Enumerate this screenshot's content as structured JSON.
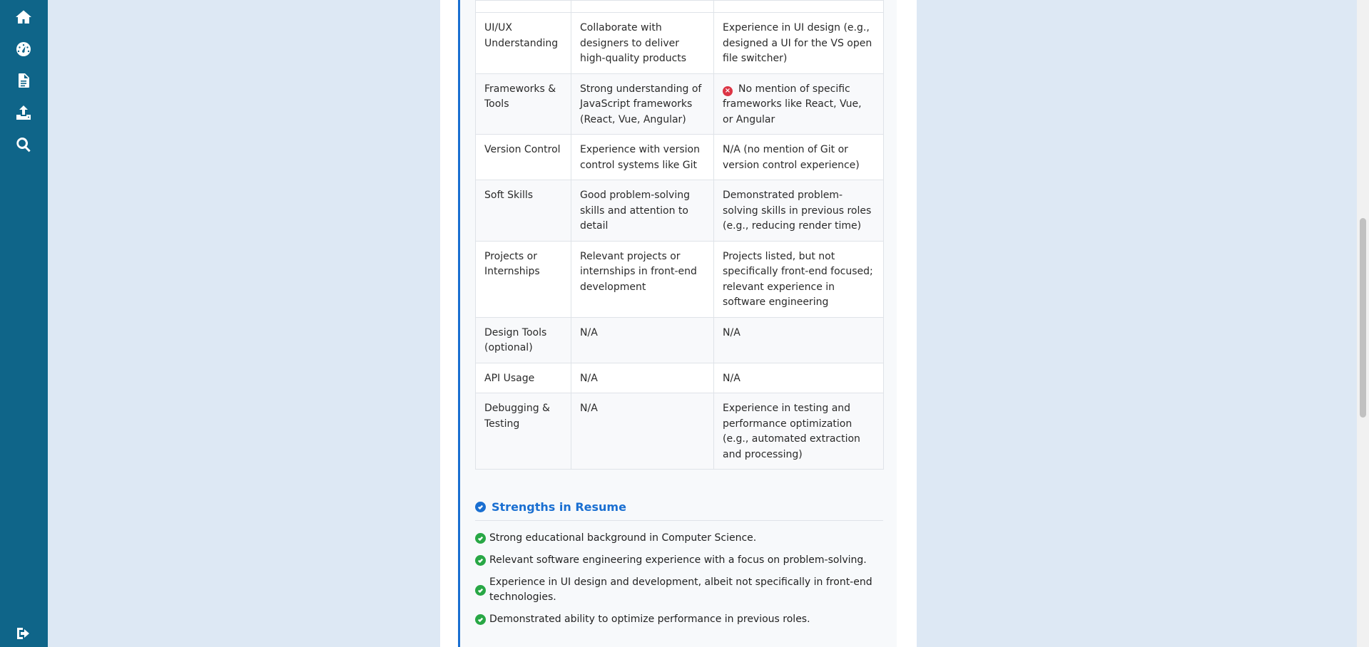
{
  "sidebar": {
    "icons": [
      "home-icon",
      "dashboard-icon",
      "document-icon",
      "upload-icon",
      "search-icon",
      "logout-icon"
    ]
  },
  "table": {
    "rows": [
      {
        "criterion": "UI/UX Understanding",
        "requirement": "Collaborate with designers to deliver high-quality products",
        "resume": "Experience in UI design (e.g., designed a UI for the VS open file switcher)",
        "missing": false
      },
      {
        "criterion": "Frameworks & Tools",
        "requirement": "Strong understanding of JavaScript frameworks (React, Vue, Angular)",
        "resume": "No mention of specific frameworks like React, Vue, or Angular",
        "missing": true
      },
      {
        "criterion": "Version Control",
        "requirement": "Experience with version control systems like Git",
        "resume": "N/A (no mention of Git or version control experience)",
        "missing": false
      },
      {
        "criterion": "Soft Skills",
        "requirement": "Good problem-solving skills and attention to detail",
        "resume": "Demonstrated problem-solving skills in previous roles (e.g., reducing render time)",
        "missing": false
      },
      {
        "criterion": "Projects or Internships",
        "requirement": "Relevant projects or internships in front-end development",
        "resume": "Projects listed, but not specifically front-end focused; relevant experience in software engineering",
        "missing": false
      },
      {
        "criterion": "Design Tools (optional)",
        "requirement": "N/A",
        "resume": "N/A",
        "missing": false
      },
      {
        "criterion": "API Usage",
        "requirement": "N/A",
        "resume": "N/A",
        "missing": false
      },
      {
        "criterion": "Debugging & Testing",
        "requirement": "N/A",
        "resume": "Experience in testing and performance optimization (e.g., automated extraction and processing)",
        "missing": false
      }
    ]
  },
  "strengths": {
    "title": "Strengths in Resume",
    "items": [
      "Strong educational background in Computer Science.",
      "Relevant software engineering experience with a focus on problem-solving.",
      "Experience in UI design and development, albeit not specifically in front-end technologies.",
      "Demonstrated ability to optimize performance in previous roles."
    ]
  },
  "colors": {
    "sidebar": "#0f6589",
    "accent": "#1a6fd1",
    "success": "#28a745",
    "danger": "#dc3545",
    "background": "#dde8f4"
  }
}
